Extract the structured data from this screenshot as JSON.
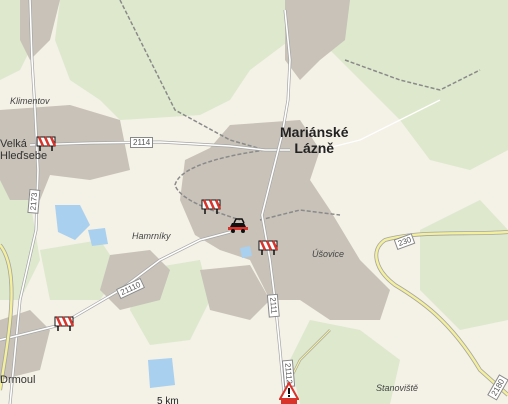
{
  "map": {
    "places": {
      "marianske_line1": "Mariánské",
      "marianske_line2": "Lázně",
      "velka_line1": "Velká",
      "velka_line2": "Hleďsebe",
      "klimentov": "Klimentov",
      "hamrniky": "Hamrníky",
      "usovice": "Úšovice",
      "drmoul": "Drmoul",
      "stanoviste": "Stanoviště"
    },
    "roads": {
      "r2114": "2114",
      "r230": "230",
      "r21110": "21110",
      "r2111": "2111",
      "r21112": "21112",
      "r2173": "2173",
      "r2180": "2180"
    },
    "scale": "5 km",
    "colors": {
      "background": "#f4f1e6",
      "forest": "#dde8cd",
      "urban": "#c8c2b8",
      "water": "#a9d0ee",
      "highway_fill": "#f3ef9a",
      "rail": "#8a8a8a"
    },
    "markers": [
      "roadwork-icon",
      "traffic-jam-icon"
    ]
  }
}
